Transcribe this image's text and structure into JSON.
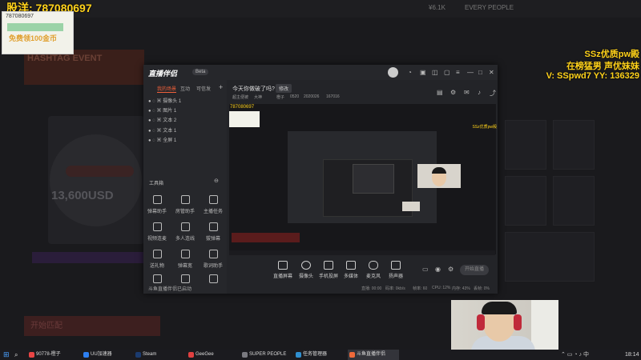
{
  "overlay": {
    "top_left_text": "股洋: 787080697",
    "qr_id": "787080697",
    "qr_text": "免费领100金币",
    "right_line1": "SSz优质pw殿",
    "right_line2": "在榜猛男 声优妹妹",
    "right_line3": "V: SSpwd7  YY: 136329"
  },
  "background": {
    "top_value": "¥6.1K",
    "top_user": "EVERY PEOPLE",
    "banner": "HASHTAG EVENT",
    "prize": "13,600USD",
    "button": "开始匹配"
  },
  "window": {
    "logo": "直播伴侣",
    "beta": "Beta",
    "tabs": [
      "我的场景",
      "互动",
      "可信发"
    ],
    "sources": [
      "摄像头 1",
      "图片 1",
      "文本 2",
      "文本 1",
      "全屏 1"
    ],
    "stream_title": "今天你做破了吗?",
    "stream_tag": "修改",
    "stream_meta": [
      "超主便被",
      "大神",
      "橙子",
      "0520",
      "2020026",
      "167016"
    ],
    "tools_title": "工具箱",
    "tools": [
      "弹幕助手",
      "房管助手",
      "主播任务",
      "视频连麦",
      "多人连线",
      "拔弹幕",
      "送礼物",
      "弹幕宽",
      "歌词助手"
    ],
    "status_bottom": "斗鱼直播伴侣已启动",
    "controls": [
      "直播屏幕",
      "摄像头",
      "手机投屏",
      "多媒体",
      "麦克风",
      "扬声器"
    ],
    "live_button": "开始直播",
    "stats": [
      "直播: 00:00",
      "码率: 0kb/s",
      "帧率: 60",
      "CPU: 12%",
      "内存: 43%",
      "丢帧: 0%"
    ]
  },
  "taskbar": {
    "items": [
      {
        "label": "90778-橙子",
        "color": "#e94545"
      },
      {
        "label": "UU加速器",
        "color": "#2d7ff0"
      },
      {
        "label": "Steam",
        "color": "#1b3b6f"
      },
      {
        "label": "GeeGee",
        "color": "#e04040"
      },
      {
        "label": "SUPER PEOPLE",
        "color": "#7a7a80"
      },
      {
        "label": "任务管理器",
        "color": "#2f8fd0"
      },
      {
        "label": "斗鱼直播伴侣",
        "color": "#f06a3a"
      }
    ],
    "time": "18:14"
  },
  "colors": {
    "accent": "#f0603a",
    "overlay_yellow": "#ffd21a"
  }
}
